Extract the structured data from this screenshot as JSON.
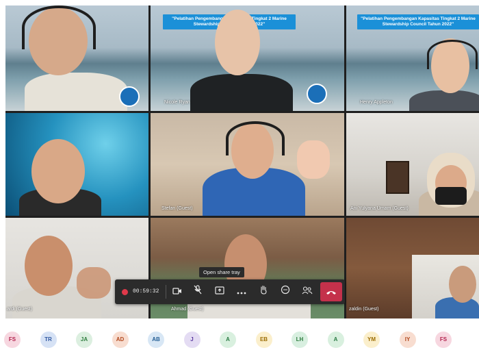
{
  "tiles": [
    {
      "id": "t1",
      "name": "",
      "banner": ""
    },
    {
      "id": "t2",
      "name": "Nicole Ryan",
      "banner": "\"Pelatihan Pengembangan Kapasitas Tingkat 2 Marine Stewardship Council Tahun 2022\""
    },
    {
      "id": "t3",
      "name": "Henry Appleton",
      "banner": "\"Pelatihan Pengembangan Kapasitas Tingkat 2 Marine Stewardship Council Tahun 2022\""
    },
    {
      "id": "t4",
      "name": "",
      "banner": ""
    },
    {
      "id": "t5",
      "name": "Stefan (Guest)",
      "banner": ""
    },
    {
      "id": "t6",
      "name": "Ani Yulyana Umam (Guest)",
      "banner": ""
    },
    {
      "id": "t7",
      "name": "ardi (Guest)",
      "banner": ""
    },
    {
      "id": "t8",
      "name": "Ahmad (Guest)",
      "banner": ""
    },
    {
      "id": "t9",
      "name": "zaldin (Guest)",
      "banner": ""
    }
  ],
  "toolbar": {
    "timer": "00:59:32",
    "tooltip": "Open share tray",
    "icons": [
      "camera-icon",
      "mic-off-icon",
      "share-icon",
      "more-icon",
      "raise-hand-icon",
      "chat-icon",
      "participants-icon"
    ],
    "leave_icon": "hang-up-icon",
    "leave_color": "#c4314b"
  },
  "avatars": [
    {
      "initials": "FS",
      "bg": "#f7d7e0",
      "fg": "#b3224d"
    },
    {
      "initials": "TR",
      "bg": "#d6e2f5",
      "fg": "#2f57a0"
    },
    {
      "initials": "JA",
      "bg": "#dcefe0",
      "fg": "#2e7d3e"
    },
    {
      "initials": "AD",
      "bg": "#f8ddd0",
      "fg": "#b1481d"
    },
    {
      "initials": "AB",
      "bg": "#d8e7f5",
      "fg": "#245e94"
    },
    {
      "initials": "J",
      "bg": "#e4dcf3",
      "fg": "#5b3aa0"
    },
    {
      "initials": "A",
      "bg": "#d9f0df",
      "fg": "#2b7b44"
    },
    {
      "initials": "EB",
      "bg": "#fbefcc",
      "fg": "#9a6b00"
    },
    {
      "initials": "LH",
      "bg": "#d8efe0",
      "fg": "#2e7d3e"
    },
    {
      "initials": "A",
      "bg": "#d9f0df",
      "fg": "#2b7b44"
    },
    {
      "initials": "YM",
      "bg": "#fbefcc",
      "fg": "#9a6b00"
    },
    {
      "initials": "IY",
      "bg": "#f8ddd0",
      "fg": "#b1481d"
    },
    {
      "initials": "FS",
      "bg": "#f7d7e0",
      "fg": "#b3224d"
    }
  ]
}
